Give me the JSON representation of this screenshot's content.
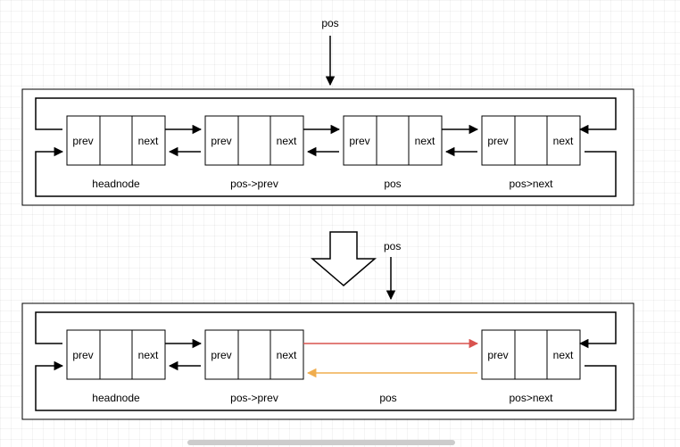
{
  "labels": {
    "pos_top": "pos",
    "pos_mid": "pos",
    "prev": "prev",
    "next": "next",
    "headnode": "headnode",
    "pos_prev": "pos->prev",
    "pos_label": "pos",
    "pos_next": "pos>next"
  },
  "diagram": {
    "description": "Doubly linked list node deletion. Top: original list with nodes headnode, pos->prev, pos, pos>next linked forward and backward, with wrap-around links between headnode and pos>next. A 'pos' pointer arrow points to the third node. Bottom: after removal of pos, pos->prev's next link (red) goes directly to pos>next, and pos>next's prev link (orange) goes directly to pos->prev. Big down arrow between diagrams indicates transition.",
    "nodes_top": [
      "headnode",
      "pos->prev",
      "pos",
      "pos>next"
    ],
    "nodes_bottom_visible": [
      "headnode",
      "pos->prev",
      "pos>next"
    ],
    "removed_node": "pos",
    "new_links": [
      {
        "from": "pos->prev",
        "to": "pos>next",
        "field": "next",
        "color": "#d9534f"
      },
      {
        "from": "pos>next",
        "to": "pos->prev",
        "field": "prev",
        "color": "#f0ad4e"
      }
    ]
  }
}
